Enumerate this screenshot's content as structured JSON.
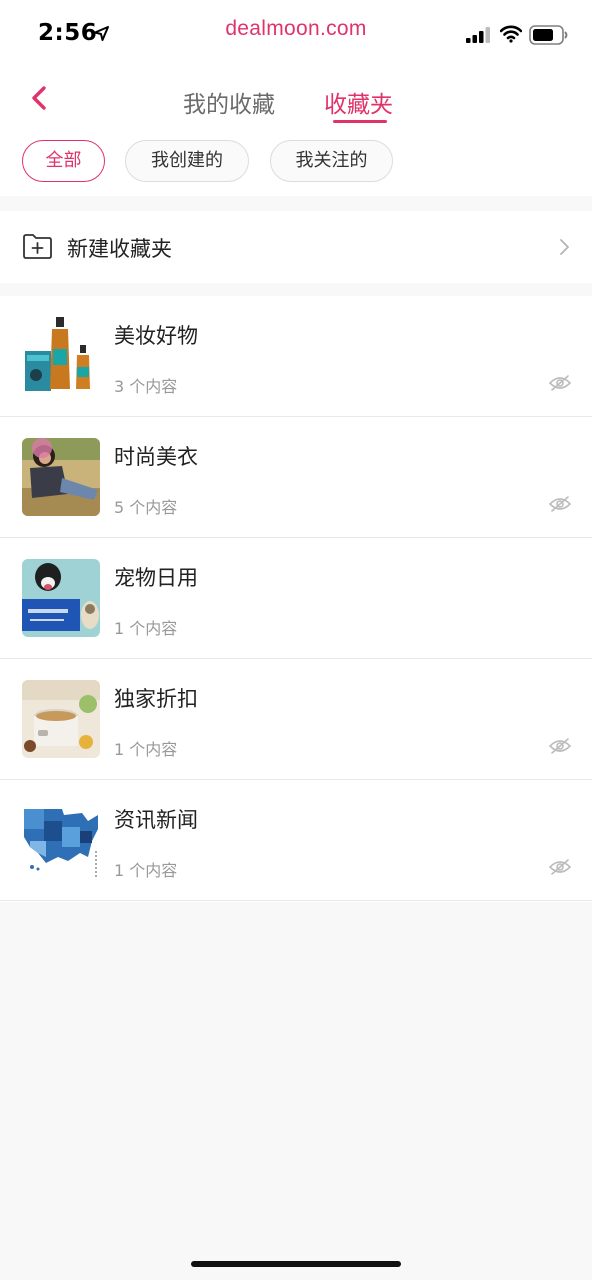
{
  "status_bar": {
    "time": "2:56",
    "url": "dealmoon.com",
    "icons": [
      "location-arrow-icon",
      "signal-icon",
      "wifi-icon",
      "battery-icon"
    ]
  },
  "header": {
    "back_icon": "chevron-left-icon",
    "tabs": [
      {
        "label": "我的收藏",
        "active": false
      },
      {
        "label": "收藏夹",
        "active": true
      }
    ]
  },
  "filters": [
    {
      "label": "全部",
      "active": true
    },
    {
      "label": "我创建的",
      "active": false
    },
    {
      "label": "我关注的",
      "active": false
    }
  ],
  "new_folder": {
    "label": "新建收藏夹",
    "icon": "folder-plus-icon"
  },
  "folders": [
    {
      "title": "美妆好物",
      "count": "3 个内容",
      "private": true
    },
    {
      "title": "时尚美衣",
      "count": "5 个内容",
      "private": true
    },
    {
      "title": "宠物日用",
      "count": "1 个内容",
      "private": false
    },
    {
      "title": "独家折扣",
      "count": "1 个内容",
      "private": true
    },
    {
      "title": "资讯新闻",
      "count": "1 个内容",
      "private": true
    }
  ],
  "colors": {
    "accent": "#e0336a",
    "background": "#f8f8f8",
    "muted_text": "#999999"
  }
}
